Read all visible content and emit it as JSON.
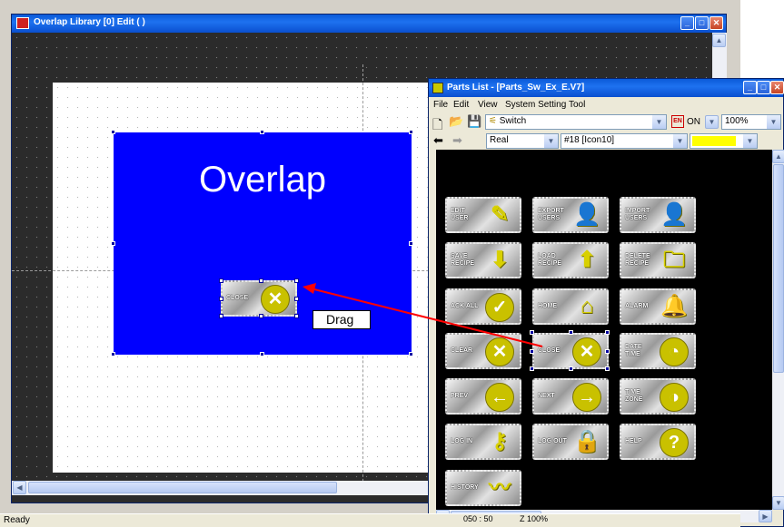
{
  "editor": {
    "title": "Overlap Library [0] Edit (                )",
    "overlap_label": "Overlap",
    "close_part_label": "CLOSE"
  },
  "annotation": {
    "drag_label": "Drag",
    "arrow_color": "#ff0000"
  },
  "status": {
    "ready": "Ready",
    "coords": "050 : 50",
    "zoom": "Z 100%"
  },
  "parts_window": {
    "title": "Parts List - [Parts_Sw_Ex_E.V7]",
    "menu": [
      "File",
      "Edit",
      "View",
      "System Setting",
      "Tool"
    ],
    "toolbar": {
      "switch_combo": "Switch",
      "on_label": "ON",
      "zoom_combo": "100%",
      "type_combo": "Real",
      "icon_combo": "#18 [Icon10]",
      "color_swatch": "#ffff00"
    },
    "parts": [
      {
        "label": "EDIT\nUSER",
        "icon": "pen-icon"
      },
      {
        "label": "EXPORT\nUSERS",
        "icon": "user-export-icon"
      },
      {
        "label": "IMPORT\nUSERS",
        "icon": "user-import-icon"
      },
      {
        "label": "SAVE\nRECIPE",
        "icon": "folder-down-icon"
      },
      {
        "label": "LOAD\nRECIPE",
        "icon": "folder-up-icon"
      },
      {
        "label": "DELETE\nRECIPE",
        "icon": "folder-delete-icon"
      },
      {
        "label": "ACK ALL",
        "icon": "check-circle-icon"
      },
      {
        "label": "HOME",
        "icon": "home-icon"
      },
      {
        "label": "ALARM",
        "icon": "bell-icon"
      },
      {
        "label": "CLEAR",
        "icon": "x-circle-icon"
      },
      {
        "label": "CLOSE",
        "icon": "x-circle-icon"
      },
      {
        "label": "DATE\nTIME",
        "icon": "clock-icon"
      },
      {
        "label": "PREV",
        "icon": "arrow-left-circle-icon"
      },
      {
        "label": "NEXT",
        "icon": "arrow-right-circle-icon"
      },
      {
        "label": "TIME\nZONE",
        "icon": "globe-clock-icon"
      },
      {
        "label": "LOG IN",
        "icon": "key-icon"
      },
      {
        "label": "LOG OUT",
        "icon": "lock-icon"
      },
      {
        "label": "HELP",
        "icon": "question-circle-icon"
      },
      {
        "label": "HISTORY",
        "icon": "trend-icon"
      }
    ]
  }
}
